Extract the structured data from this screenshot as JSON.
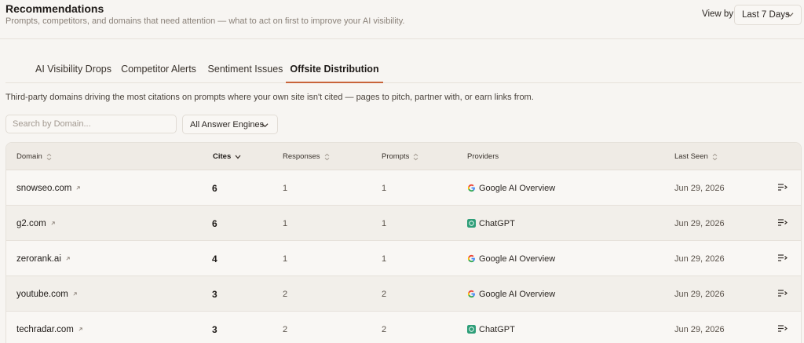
{
  "header": {
    "title": "Recommendations",
    "subtitle": "Prompts, competitors, and domains that need attention — what to act on first to improve your AI visibility.",
    "view_by_label": "View by",
    "view_by_value": "Last 7 Days"
  },
  "tabs": [
    {
      "label": "AI Visibility Drops",
      "active": false
    },
    {
      "label": "Competitor Alerts",
      "active": false
    },
    {
      "label": "Sentiment Issues",
      "active": false
    },
    {
      "label": "Offsite Distribution",
      "active": true
    }
  ],
  "description": "Third-party domains driving the most citations on prompts where your own site isn't cited — pages to pitch, partner with, or earn links from.",
  "filters": {
    "search_placeholder": "Search by Domain...",
    "engine_value": "All Answer Engines"
  },
  "table": {
    "columns": {
      "domain": "Domain",
      "cites": "Cites",
      "responses": "Responses",
      "prompts": "Prompts",
      "providers": "Providers",
      "last_seen": "Last Seen"
    },
    "sorted_by": "cites",
    "rows": [
      {
        "domain": "snowseo.com",
        "cites": "6",
        "responses": "1",
        "prompts": "1",
        "provider": "Google AI Overview",
        "provider_icon": "google-icon",
        "last_seen": "Jun 29, 2026"
      },
      {
        "domain": "g2.com",
        "cites": "6",
        "responses": "1",
        "prompts": "1",
        "provider": "ChatGPT",
        "provider_icon": "chatgpt-icon",
        "last_seen": "Jun 29, 2026"
      },
      {
        "domain": "zerorank.ai",
        "cites": "4",
        "responses": "1",
        "prompts": "1",
        "provider": "Google AI Overview",
        "provider_icon": "google-icon",
        "last_seen": "Jun 29, 2026"
      },
      {
        "domain": "youtube.com",
        "cites": "3",
        "responses": "2",
        "prompts": "2",
        "provider": "Google AI Overview",
        "provider_icon": "google-icon",
        "last_seen": "Jun 29, 2026"
      },
      {
        "domain": "techradar.com",
        "cites": "3",
        "responses": "2",
        "prompts": "2",
        "provider": "ChatGPT",
        "provider_icon": "chatgpt-icon",
        "last_seen": "Jun 29, 2026"
      }
    ]
  },
  "colors": {
    "accent": "#c8643a",
    "background": "#f7f5f2",
    "header_row": "#efebe5",
    "chatgpt_green": "#2e9e78"
  }
}
